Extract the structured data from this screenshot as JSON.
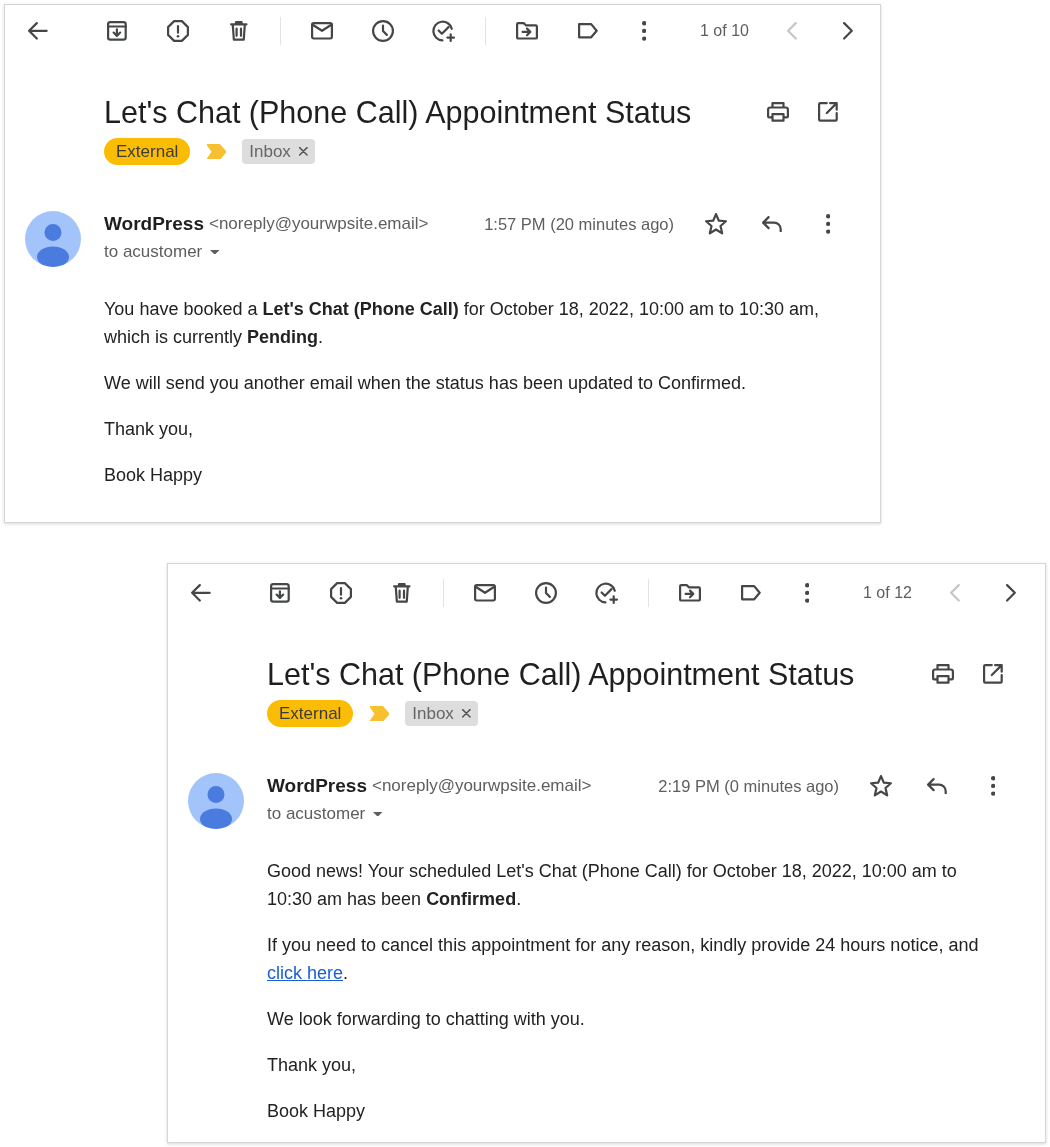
{
  "emails": [
    {
      "pager": {
        "counter": "1 of 10",
        "prev_disabled": true,
        "next_disabled": false
      },
      "subject": "Let's Chat (Phone Call) Appointment Status",
      "labels": [
        {
          "kind": "category",
          "text": "External"
        },
        {
          "kind": "marker",
          "important": true
        },
        {
          "kind": "folder",
          "text": "Inbox",
          "removable": true
        }
      ],
      "sender": {
        "name": "WordPress",
        "address": "<noreply@yourwpsite.email>",
        "recipient": "to acustomer",
        "time": "1:57 PM (20 minutes ago)",
        "starred": false
      },
      "body": [
        {
          "text": "You have booked a **Let's Chat (Phone Call)** for October 18, 2022, 10:00 am to 10:30 am, which is currently **Pending**."
        },
        {
          "text": "We will send you another email when the status has been updated to Confirmed."
        },
        {
          "text": "Thank you,"
        },
        {
          "text": "Book Happy"
        }
      ]
    },
    {
      "pager": {
        "counter": "1 of 12",
        "prev_disabled": true,
        "next_disabled": false
      },
      "subject": "Let's Chat (Phone Call) Appointment Status",
      "labels": [
        {
          "kind": "category",
          "text": "External"
        },
        {
          "kind": "marker",
          "important": true
        },
        {
          "kind": "folder",
          "text": "Inbox",
          "removable": true
        }
      ],
      "sender": {
        "name": "WordPress",
        "address": "<noreply@yourwpsite.email>",
        "recipient": "to acustomer",
        "time": "2:19 PM (0 minutes ago)",
        "starred": false
      },
      "body": [
        {
          "text": "Good news! Your scheduled Let's Chat (Phone Call) for October 18, 2022, 10:00 am to 10:30 am has been **Confirmed**."
        },
        {
          "text": "If you need to cancel this appointment for any reason, kindly provide 24 hours notice, and",
          "link": "click here",
          "tail": "."
        },
        {
          "text": "We look forwarding to chatting with you."
        },
        {
          "text": "Thank you,"
        },
        {
          "text": "Book Happy"
        }
      ]
    }
  ]
}
